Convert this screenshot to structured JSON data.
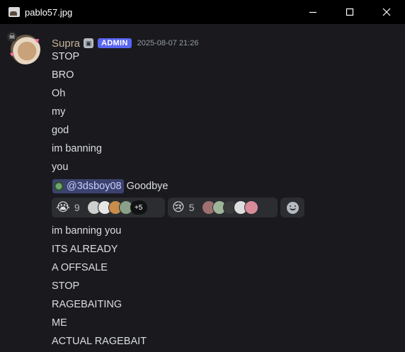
{
  "window": {
    "title": "pablo57.jpg",
    "icon": "image-file-icon"
  },
  "message": {
    "username": "Supra",
    "role_badge": "ADMIN",
    "timestamp": "2025-08-07 21:26",
    "lines_before": [
      "STOP",
      "BRO",
      "Oh",
      "my",
      "god",
      "im banning",
      "you"
    ],
    "mention": {
      "handle": "@3dsboy08",
      "rest": "Goodbye"
    },
    "reactions": [
      {
        "emoji": "😭",
        "count": "9",
        "more_label": "+5"
      },
      {
        "emoji": "😢",
        "count": "5"
      }
    ],
    "lines_after": [
      "im banning you",
      "ITS ALREADY",
      "A OFFSALE",
      "STOP",
      "RAGEBAITING",
      "ME",
      "ACTUAL RAGEBAIT"
    ]
  },
  "colors": {
    "background": "#1a1a1e",
    "titlebar": "#000000",
    "admin_badge": "#5865f2",
    "mention_bg": "#3c4270",
    "username": "#c6b19a"
  }
}
